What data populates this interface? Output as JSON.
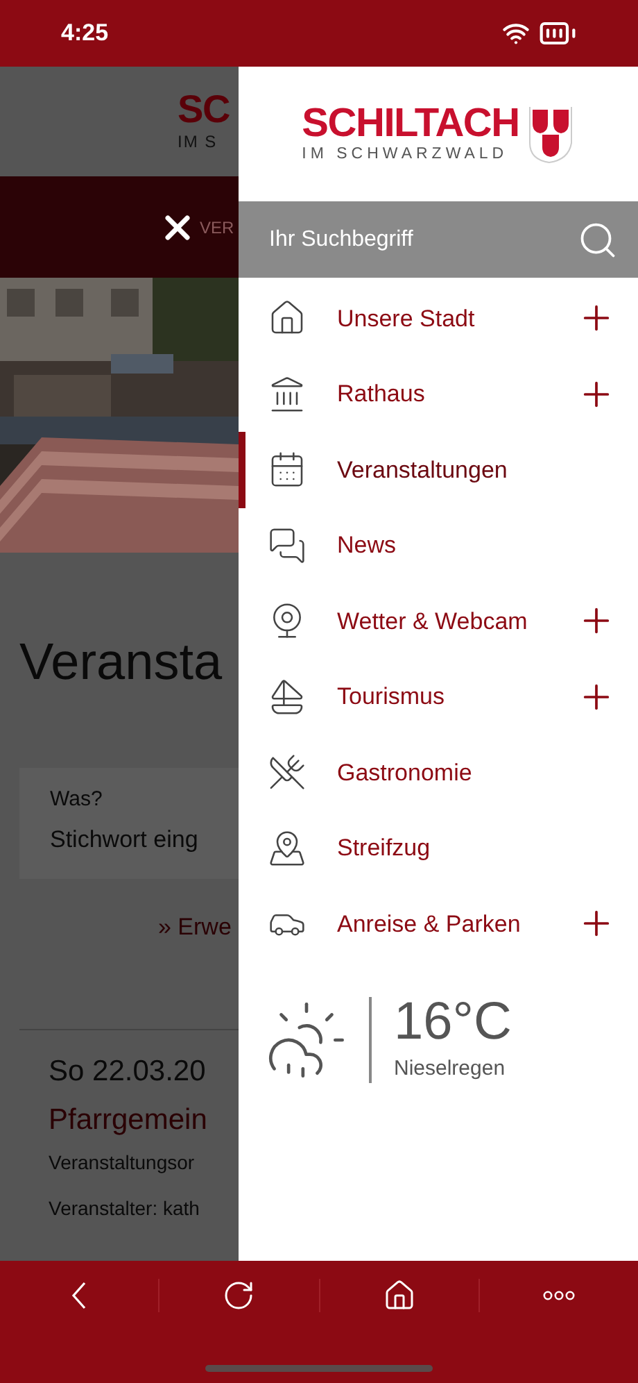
{
  "status_bar": {
    "time": "4:25"
  },
  "background_page": {
    "logo_text": "SC",
    "logo_subtitle": "IM S",
    "nav_label": "VER",
    "heading": "Veransta",
    "search": {
      "label": "Was?",
      "placeholder": "Stichwort eing"
    },
    "advanced_link": "» Erwe",
    "event": {
      "date": "So 22.03.20",
      "title": "Pfarrgemein",
      "location": "Veranstaltungsor",
      "organizer": "Veranstalter: kath"
    }
  },
  "drawer": {
    "logo": {
      "title": "SCHILTACH",
      "subtitle": "IM SCHWARZWALD"
    },
    "search": {
      "placeholder": "Ihr Suchbegriff"
    },
    "menu": [
      {
        "label": "Unsere Stadt",
        "expandable": true,
        "selected": false
      },
      {
        "label": "Rathaus",
        "expandable": true,
        "selected": false
      },
      {
        "label": "Veranstaltungen",
        "expandable": false,
        "selected": true
      },
      {
        "label": "News",
        "expandable": false,
        "selected": false
      },
      {
        "label": "Wetter & Webcam",
        "expandable": true,
        "selected": false
      },
      {
        "label": "Tourismus",
        "expandable": true,
        "selected": false
      },
      {
        "label": "Gastronomie",
        "expandable": false,
        "selected": false
      },
      {
        "label": "Streifzug",
        "expandable": false,
        "selected": false
      },
      {
        "label": "Anreise & Parken",
        "expandable": true,
        "selected": false
      }
    ],
    "weather": {
      "temperature": "16°C",
      "condition": "Nieselregen"
    }
  }
}
